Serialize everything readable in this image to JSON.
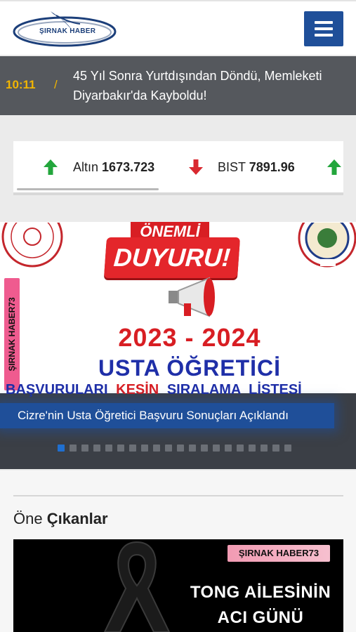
{
  "header": {
    "logo_text": "ŞIRNAK HABER",
    "menu_icon": "hamburger-menu-icon"
  },
  "breaking": {
    "time": "10:11",
    "separator": "/",
    "headline": "45 Yıl Sonra Yurtdışından Döndü, Memleketi Diyarbakır'da Kayboldu!"
  },
  "ticker": {
    "items": [
      {
        "label": "Altın",
        "value": "1673.723",
        "direction": "up",
        "icon": "arrow-up-icon"
      },
      {
        "label": "BIST",
        "value": "7891.96",
        "direction": "down",
        "icon": "arrow-down-icon"
      }
    ],
    "colors": {
      "up": "#23a63c",
      "down": "#d9282f"
    }
  },
  "slider": {
    "image": {
      "onemli": "ÖNEMLİ",
      "duyuru": "DUYURU!",
      "side_tag": "ŞIRNAK HABER73",
      "years": "2023 - 2024",
      "usta": "USTA ÖĞRETİCİ",
      "basvuru_part1": "BAŞVURULARI",
      "basvuru_part2": "KESİN",
      "basvuru_part3": "SIRALAMA LİSTESİ"
    },
    "caption": "Cizre'nin Usta Öğretici Başvuru Sonuçları Açıklandı",
    "dot_count": 20,
    "active_dot": 0
  },
  "featured": {
    "title_prefix": "Öne",
    "title_bold": "Çıkanlar",
    "card": {
      "tag": "ŞIRNAK HABER73",
      "line1": "TONG AİLESİNİN",
      "line2": "ACI GÜNÜ",
      "icon": "black-ribbon-icon"
    }
  },
  "colors": {
    "brand_blue": "#1f4f99",
    "breaking_bg": "#55585d",
    "time_yellow": "#f2b500",
    "headline_red": "#d81e23"
  }
}
